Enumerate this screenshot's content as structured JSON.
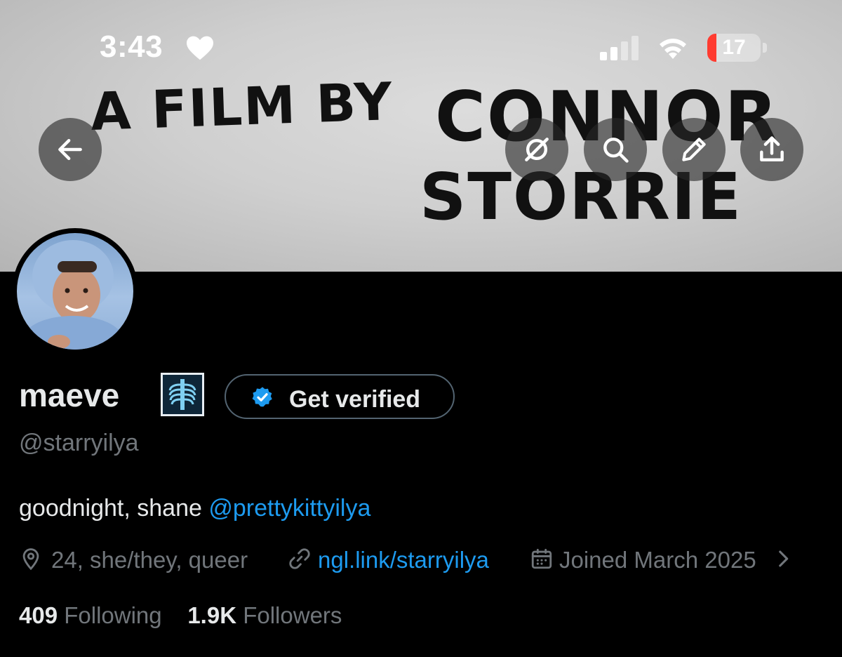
{
  "status_bar": {
    "time": "3:43",
    "battery_level": "17",
    "battery_fraction": 0.17,
    "icons": [
      "heart-icon",
      "cellular-signal-icon",
      "wifi-icon",
      "battery-icon"
    ]
  },
  "banner": {
    "line1": "A FILM BY",
    "line2": "CONNOR",
    "line3": "STORRIE"
  },
  "header_buttons": [
    "back-arrow-icon",
    "grok-icon",
    "search-icon",
    "edit-pencil-icon",
    "share-icon"
  ],
  "profile": {
    "display_name": "maeve",
    "name_emoji": "x-ray",
    "verify_button_label": "Get verified",
    "handle": "@starryilya",
    "bio_text": "goodnight, shane ",
    "bio_mention": "@prettykittyilya",
    "location": "24, she/they, queer",
    "link": "ngl.link/starryilya",
    "joined": "Joined March 2025",
    "following_count": "409",
    "following_label": "Following",
    "followers_count": "1.9K",
    "followers_label": "Followers"
  },
  "colors": {
    "background": "#000000",
    "primary_text": "#e7e9ea",
    "secondary_text": "#71767b",
    "link_blue": "#1d9bf0",
    "border": "#536471",
    "battery_low": "#ff3b30"
  }
}
